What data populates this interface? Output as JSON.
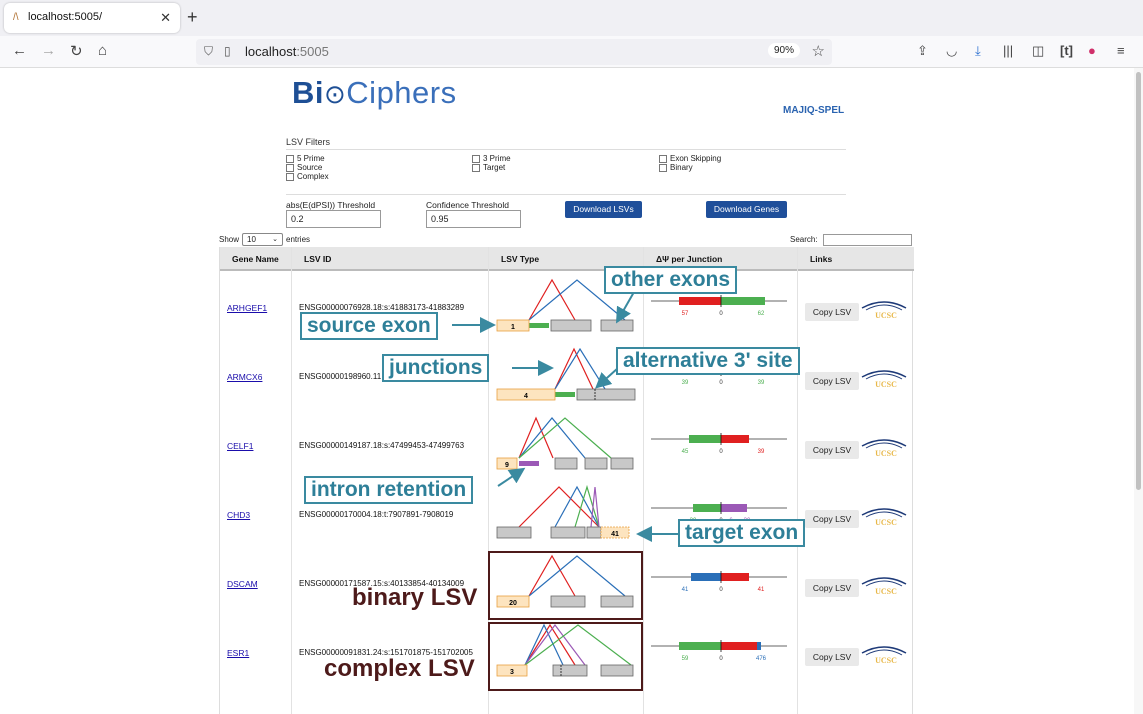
{
  "browser": {
    "tab_title": "localhost:5005/",
    "url_host": "localhost",
    "url_port": ":5005",
    "zoom": "90%"
  },
  "header": {
    "logo_part1": "Bi",
    "logo_part2": "Ciphers",
    "brand": "MAJIQ-SPEL"
  },
  "filters": {
    "title": "LSV Filters",
    "checkboxes": [
      "5 Prime",
      "Source",
      "Complex",
      "3 Prime",
      "Target",
      "Exon Skipping",
      "Binary"
    ],
    "threshold_label": "abs(E(dPSI)) Threshold",
    "threshold_value": "0.2",
    "confidence_label": "Confidence Threshold",
    "confidence_value": "0.95",
    "download_lsvs": "Download LSVs",
    "download_genes": "Download Genes"
  },
  "table_controls": {
    "show_label": "Show",
    "page_length": "10",
    "entries_label": "entries",
    "search_label": "Search:"
  },
  "table": {
    "headers": [
      "Gene Name",
      "LSV ID",
      "LSV Type",
      "ΔΨ per Junction",
      "Links"
    ],
    "rows": [
      {
        "gene": "ARHGEF1",
        "lsv_id": "ENSG00000076928.18:s:41883173-41883289",
        "exon_label": "1",
        "dpsi": [
          "57",
          "0",
          "62"
        ]
      },
      {
        "gene": "ARMCX6",
        "lsv_id": "ENSG00000198960.11",
        "exon_label": "4",
        "dpsi": [
          "39",
          "0",
          "39"
        ]
      },
      {
        "gene": "CELF1",
        "lsv_id": "ENSG00000149187.18:s:47499453-47499763",
        "exon_label": "9",
        "dpsi": [
          "45",
          "0",
          "39"
        ]
      },
      {
        "gene": "CHD3",
        "lsv_id": "ENSG00000170004.18:t:7907891-7908019",
        "exon_label": "41",
        "dpsi": [
          "30",
          "0",
          "6",
          "30"
        ]
      },
      {
        "gene": "DSCAM",
        "lsv_id": "ENSG00000171587.15:s:40133854-40134009",
        "exon_label": "20",
        "dpsi": [
          "41",
          "0",
          "41"
        ]
      },
      {
        "gene": "ESR1",
        "lsv_id": "ENSG00000091831.24:s:151701875-151702005",
        "exon_label": "3",
        "dpsi": [
          "59",
          "0",
          "476"
        ]
      }
    ],
    "copy_label": "Copy LSV",
    "ucsc_label": "UCSC"
  },
  "annotations": {
    "other_exons": "other exons",
    "source_exon": "source exon",
    "junctions": "junctions",
    "alt3": "alternative 3' site",
    "intron_retention": "intron retention",
    "target_exon": "target exon",
    "binary_lsv": "binary LSV",
    "complex_lsv": "complex LSV"
  },
  "colors": {
    "callout": "#3a8aa0",
    "dark_label": "#4d1a1a",
    "positive": "#4caf50",
    "negative": "#e02020",
    "blue": "#2a6fb8",
    "purple": "#9b59b6",
    "source_exon": "#fde4bf",
    "gray_exon": "#c8c8c8"
  }
}
